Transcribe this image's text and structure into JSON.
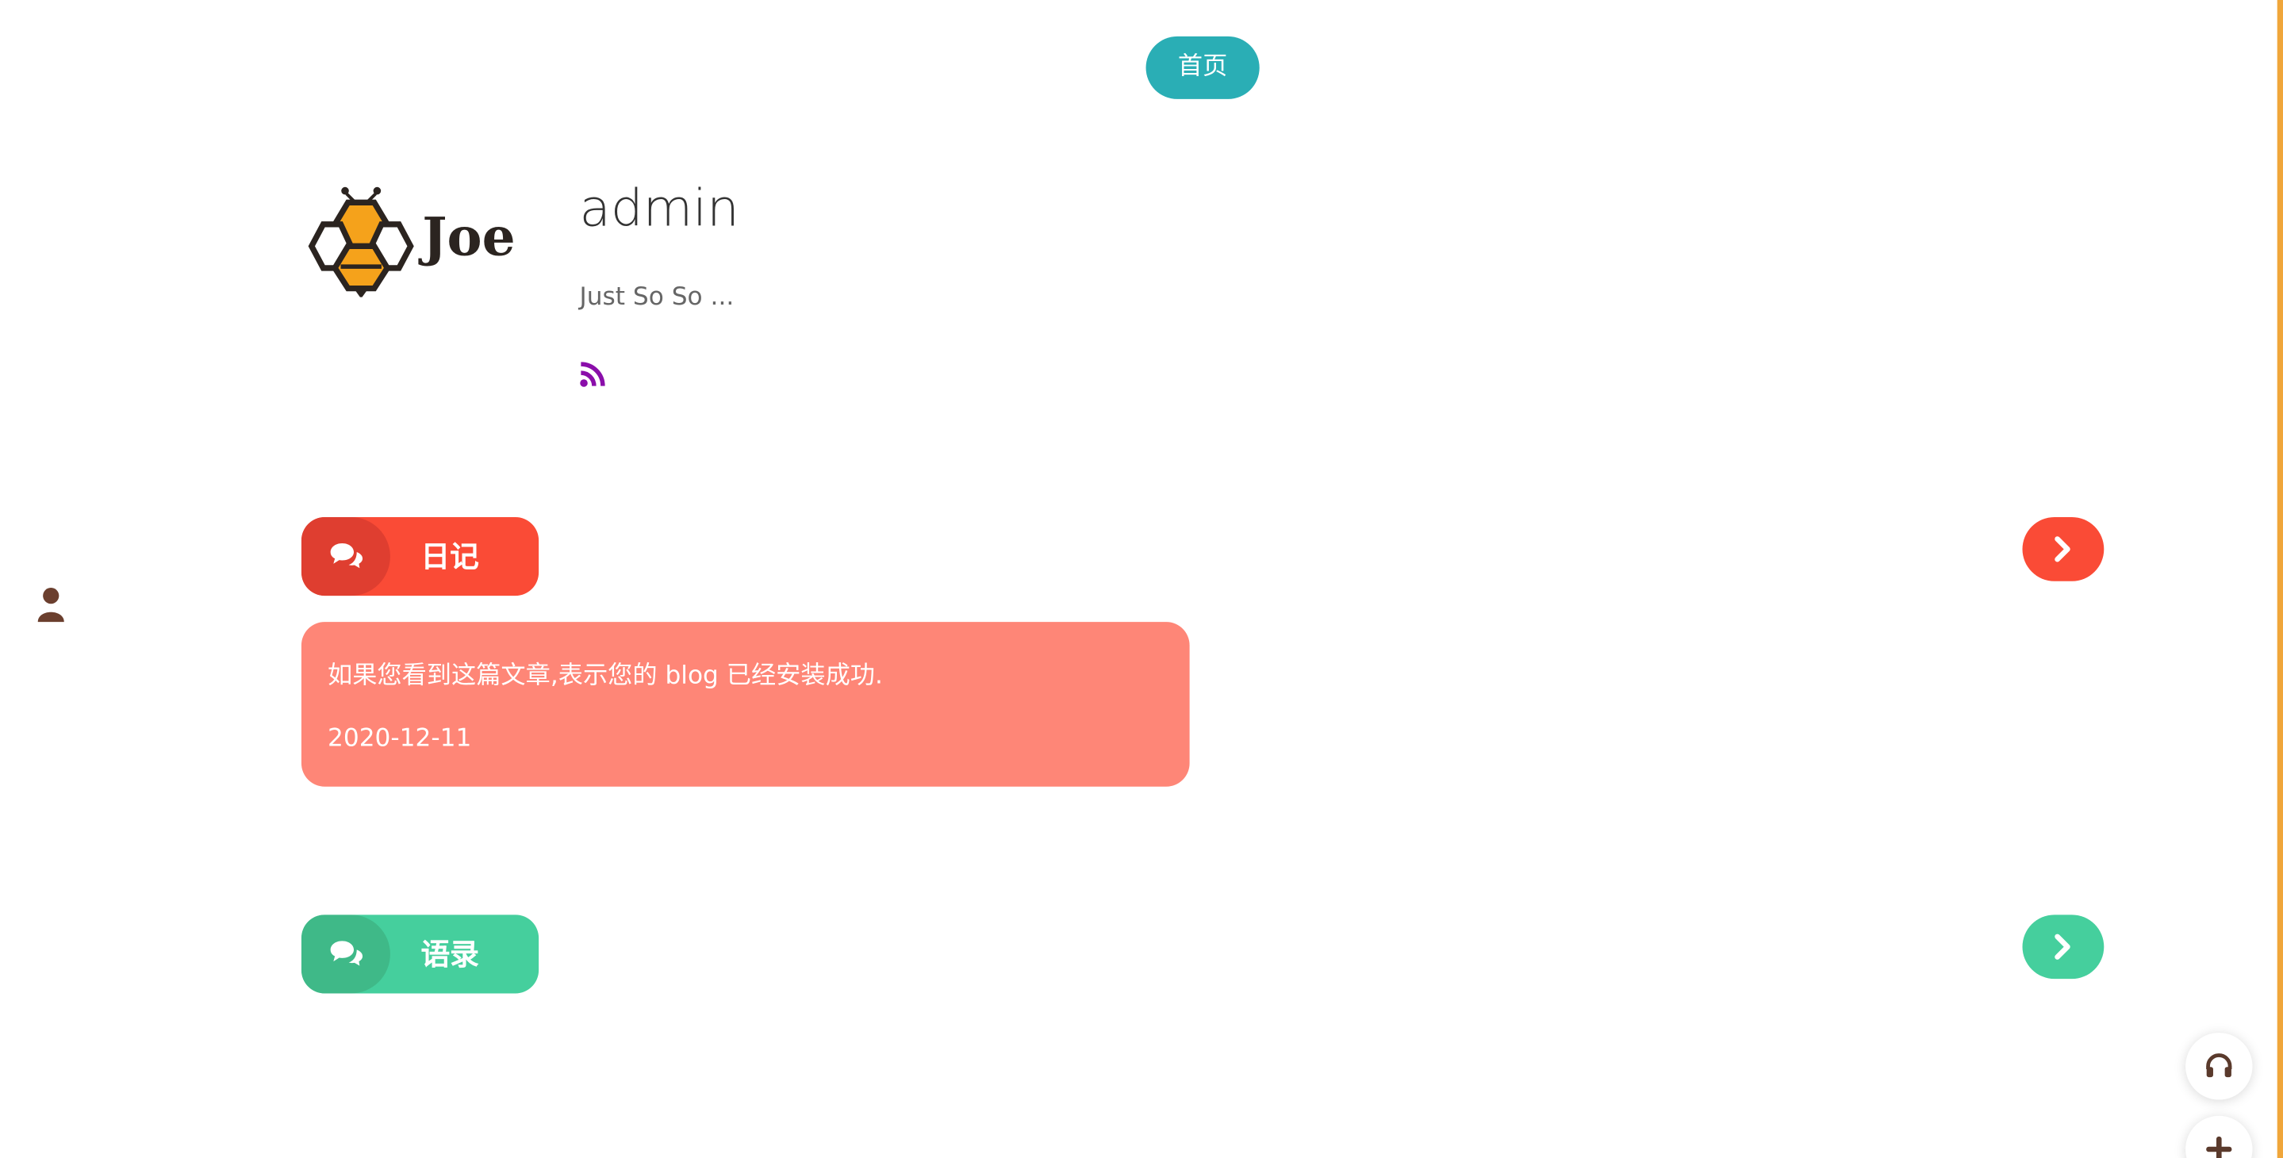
{
  "nav": {
    "home_label": "首页"
  },
  "profile": {
    "logo_text": "Joe",
    "name": "admin",
    "description": "Just So So ..."
  },
  "sections": {
    "diary": {
      "label": "日记",
      "color": "#fa4b36"
    },
    "quotes": {
      "label": "语录",
      "color": "#45cf9d"
    }
  },
  "posts": [
    {
      "title": "如果您看到这篇文章,表示您的 blog 已经安装成功.",
      "date": "2020-12-11"
    }
  ],
  "icons": {
    "rss": "rss-icon",
    "user": "user-icon",
    "comments": "comments-icon",
    "chevron": "chevron-right-icon",
    "music": "headphones-icon",
    "plus": "plus-icon"
  },
  "colors": {
    "home_button": "#2aaeb5",
    "rss": "#8a0eaa",
    "post_card": "#fe8677",
    "right_strip": "#f0a63b"
  }
}
